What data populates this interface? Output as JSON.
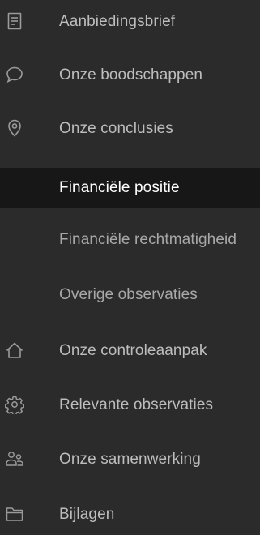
{
  "nav": {
    "items": [
      {
        "label": "Aanbiedingsbrief",
        "icon": "document-icon"
      },
      {
        "label": "Onze boodschappen",
        "icon": "speech-bubble-icon"
      },
      {
        "label": "Onze conclusies",
        "icon": "location-pin-icon"
      },
      {
        "label": "Financiële positie",
        "active": true
      },
      {
        "label": "Financiële rechtmatigheid"
      },
      {
        "label": "Overige observaties"
      },
      {
        "label": "Onze controleaanpak",
        "icon": "home-icon"
      },
      {
        "label": "Relevante observaties",
        "icon": "settings-gear-icon"
      },
      {
        "label": "Onze samenwerking",
        "icon": "people-icon"
      },
      {
        "label": "Bijlagen",
        "icon": "folder-icon"
      }
    ]
  }
}
